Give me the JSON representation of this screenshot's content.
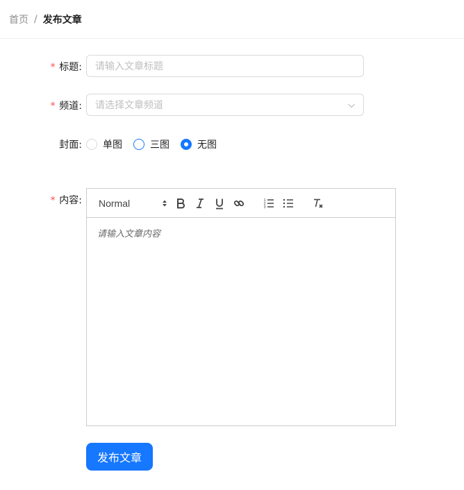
{
  "breadcrumb": {
    "home": "首页",
    "separator": "/",
    "current": "发布文章"
  },
  "form": {
    "title": {
      "required_mark": "*",
      "label": "标题:",
      "placeholder": "请输入文章标题"
    },
    "channel": {
      "required_mark": "*",
      "label": "频道:",
      "placeholder": "请选择文章频道"
    },
    "cover": {
      "label": "封面:",
      "options": [
        {
          "label": "单图",
          "checked": false
        },
        {
          "label": "三图",
          "checked": false
        },
        {
          "label": "无图",
          "checked": true
        }
      ]
    },
    "content": {
      "required_mark": "*",
      "label": "内容:",
      "toolbar": {
        "header_select": "Normal"
      },
      "placeholder": "请输入文章内容"
    },
    "submit_label": "发布文章"
  },
  "colors": {
    "primary": "#1677ff",
    "required": "#ff4d4f",
    "border": "#d9d9d9"
  },
  "icons": [
    "chevron-down-icon",
    "bold-icon",
    "italic-icon",
    "underline-icon",
    "link-icon",
    "ordered-list-icon",
    "bullet-list-icon",
    "clear-format-icon"
  ]
}
